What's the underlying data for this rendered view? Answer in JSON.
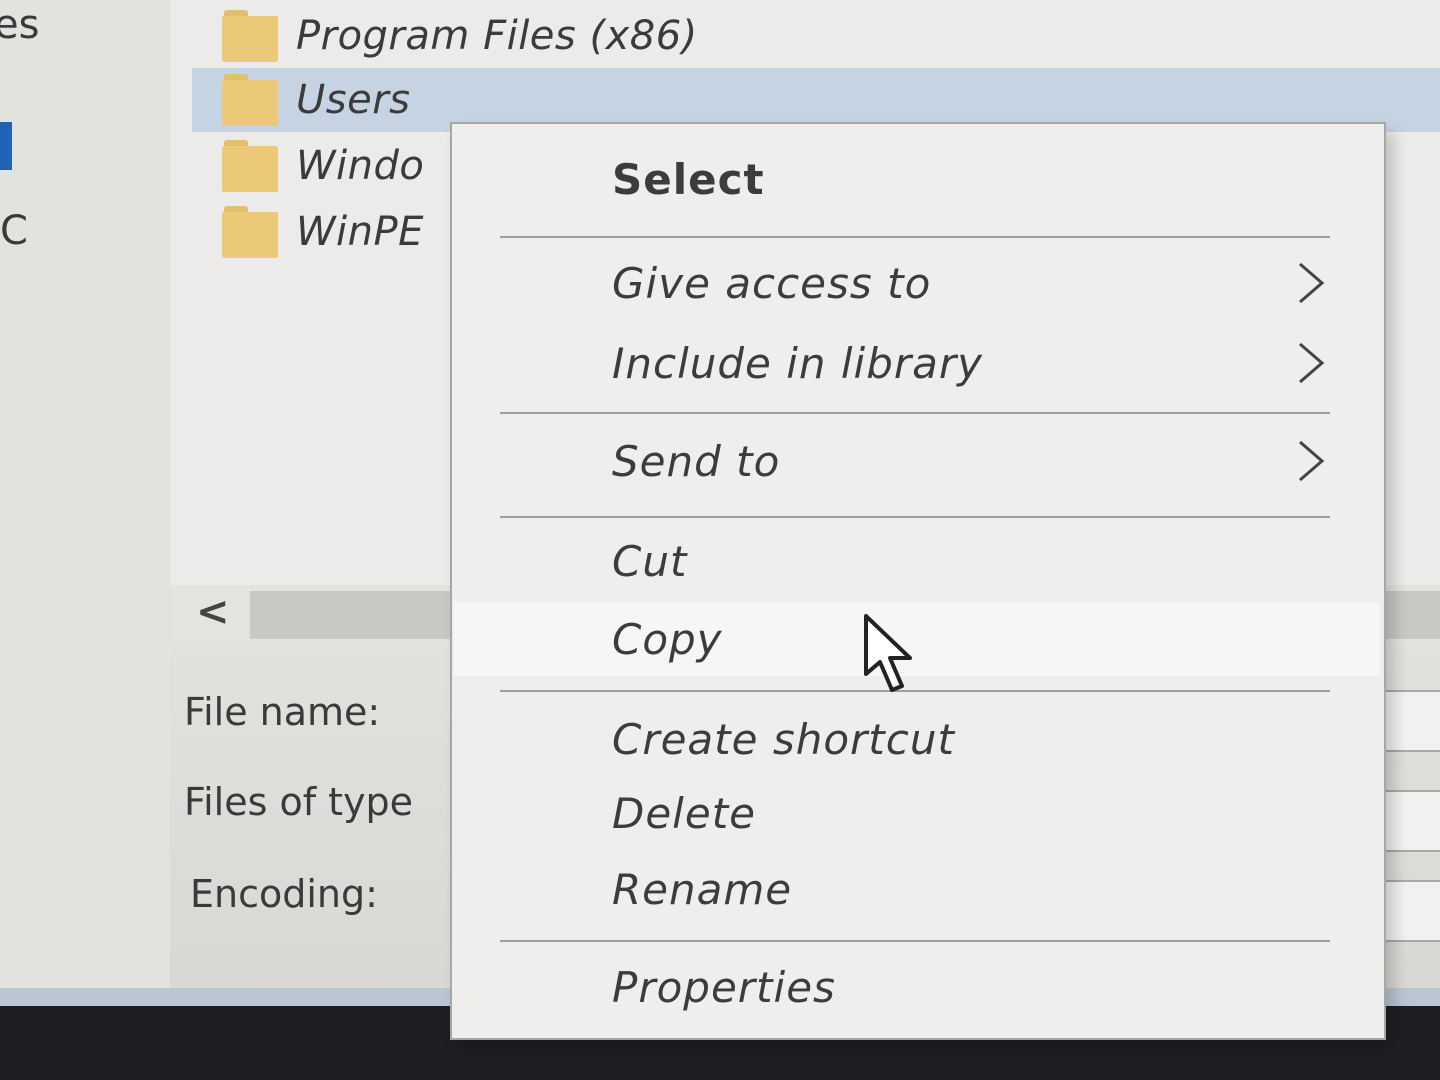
{
  "nav_pane": {
    "items": [
      {
        "label": "es"
      },
      {
        "label": "C"
      }
    ]
  },
  "file_list": {
    "rows": [
      {
        "name": "Program Files (x86)",
        "selected": false,
        "icon": "folder-icon"
      },
      {
        "name": "Users",
        "selected": true,
        "icon": "folder-icon"
      },
      {
        "name": "Windo",
        "selected": false,
        "icon": "folder-icon"
      },
      {
        "name": "WinPE",
        "selected": false,
        "icon": "folder-icon"
      }
    ]
  },
  "scrollbar": {
    "left_arrow": "<"
  },
  "dialog_fields": {
    "file_name_label": "File name:",
    "files_of_type_label": "Files of type",
    "encoding_label": "Encoding:"
  },
  "context_menu": {
    "select": "Select",
    "give_access_to": "Give access to",
    "include_in_library": "Include in library",
    "send_to": "Send to",
    "cut": "Cut",
    "copy": "Copy",
    "create_shortcut": "Create shortcut",
    "delete": "Delete",
    "rename": "Rename",
    "properties": "Properties",
    "hovered_item": "Copy"
  },
  "colors": {
    "selection": "#c6d3e2",
    "folder": "#ecc978",
    "nav_marker": "#1f63b8"
  }
}
